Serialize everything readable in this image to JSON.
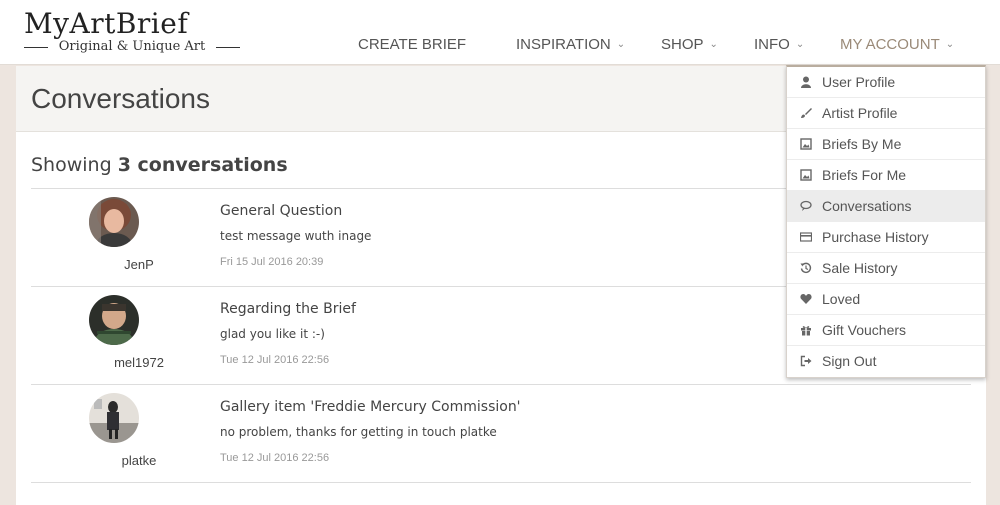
{
  "brand": {
    "logo_main": "MyArtBrief",
    "logo_sub": "Original & Unique Art"
  },
  "nav": {
    "create_brief": "CREATE BRIEF",
    "inspiration": "INSPIRATION",
    "shop": "SHOP",
    "info": "INFO",
    "my_account": "MY ACCOUNT"
  },
  "page": {
    "title": "Conversations",
    "showing_prefix": "Showing",
    "showing_count": "3 conversations"
  },
  "conversations": [
    {
      "user": "JenP",
      "subject": "General Question",
      "message": "test message wuth inage",
      "date": "Fri 15 Jul 2016 20:39"
    },
    {
      "user": "mel1972",
      "subject": "Regarding the Brief",
      "message": "glad you like it :-)",
      "date": "Tue 12 Jul 2016 22:56"
    },
    {
      "user": "platke",
      "subject": "Gallery item 'Freddie Mercury Commission'",
      "message": "no problem, thanks for getting in touch platke",
      "date": "Tue 12 Jul 2016 22:56"
    }
  ],
  "account_menu": [
    {
      "label": "User Profile",
      "icon": "user-icon"
    },
    {
      "label": "Artist Profile",
      "icon": "brush-icon"
    },
    {
      "label": "Briefs By Me",
      "icon": "picture-icon"
    },
    {
      "label": "Briefs For Me",
      "icon": "picture-icon"
    },
    {
      "label": "Conversations",
      "icon": "chat-icon",
      "active": true
    },
    {
      "label": "Purchase History",
      "icon": "credit-card-icon"
    },
    {
      "label": "Sale History",
      "icon": "history-icon"
    },
    {
      "label": "Loved",
      "icon": "heart-icon"
    },
    {
      "label": "Gift Vouchers",
      "icon": "gift-icon"
    },
    {
      "label": "Sign Out",
      "icon": "sign-out-icon"
    }
  ],
  "colors": {
    "background": "#ede5df",
    "accent_nav": "#9a8a78",
    "menu_active": "#ececec"
  }
}
